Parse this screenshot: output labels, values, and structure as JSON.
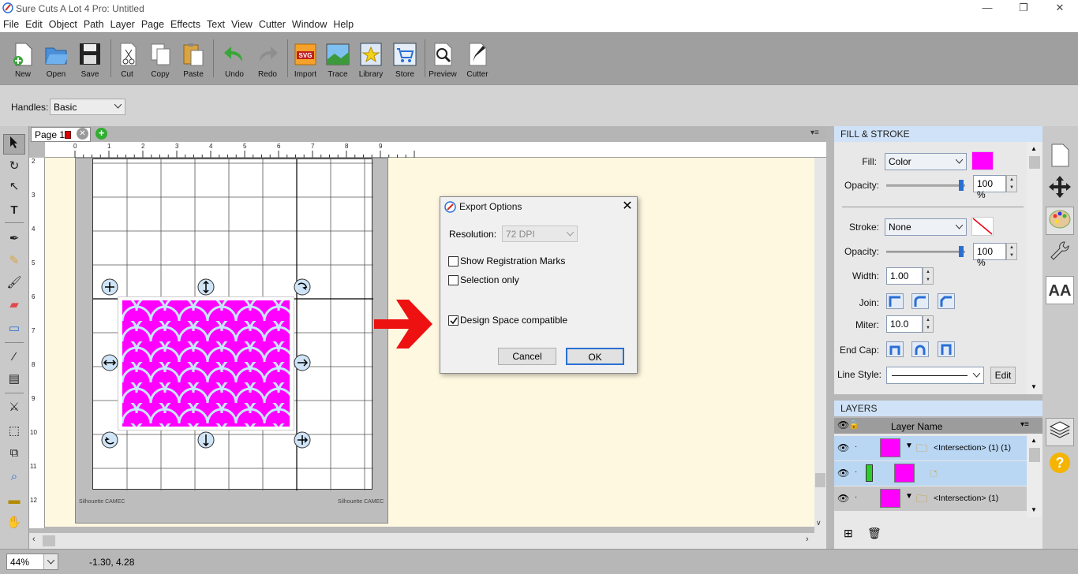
{
  "window": {
    "title": "Sure Cuts A Lot 4 Pro: Untitled",
    "minimize": "—",
    "maximize": "❐",
    "close": "✕"
  },
  "menu": [
    "File",
    "Edit",
    "Object",
    "Path",
    "Layer",
    "Page",
    "Effects",
    "Text",
    "View",
    "Cutter",
    "Window",
    "Help"
  ],
  "toolbar": {
    "new": "New",
    "open": "Open",
    "save": "Save",
    "cut": "Cut",
    "copy": "Copy",
    "paste": "Paste",
    "undo": "Undo",
    "redo": "Redo",
    "import": "Import",
    "trace": "Trace",
    "library": "Library",
    "store": "Store",
    "preview": "Preview",
    "cutter": "Cutter"
  },
  "options": {
    "handles_label": "Handles:",
    "handles_value": "Basic"
  },
  "page_tab": {
    "label": "Page 1"
  },
  "ruler": {
    "h": [
      "0",
      "1",
      "2",
      "3",
      "4",
      "5",
      "6",
      "7",
      "8",
      "9"
    ],
    "v": [
      "2",
      "3",
      "4",
      "5",
      "6",
      "7",
      "8",
      "9",
      "10",
      "11",
      "12"
    ]
  },
  "mat": {
    "brand_left": "Silhouette CAMEC",
    "brand_right": "Silhouette CAMEC"
  },
  "dialog": {
    "title": "Export Options",
    "resolution_label": "Resolution:",
    "resolution_value": "72 DPI",
    "show_registration": "Show Registration Marks",
    "selection_only": "Selection only",
    "design_space": "Design Space compatible",
    "show_registration_checked": false,
    "selection_only_checked": false,
    "design_space_checked": true,
    "cancel": "Cancel",
    "ok": "OK"
  },
  "fill_stroke": {
    "header": "FILL & STROKE",
    "fill_label": "Fill:",
    "fill_type": "Color",
    "fill_color": "#ff00ff",
    "opacity_label": "Opacity:",
    "fill_opacity": "100 %",
    "stroke_label": "Stroke:",
    "stroke_type": "None",
    "stroke_opacity": "100 %",
    "width_label": "Width:",
    "width_value": "1.00",
    "join_label": "Join:",
    "miter_label": "Miter:",
    "miter_value": "10.0",
    "endcap_label": "End Cap:",
    "linestyle_label": "Line Style:",
    "edit_label": "Edit"
  },
  "layers": {
    "header": "LAYERS",
    "col_name": "Layer Name",
    "rows": [
      {
        "name": "<Intersection> (1) (1)"
      },
      {
        "name": ""
      },
      {
        "name": "<Intersection> (1)"
      }
    ]
  },
  "status": {
    "zoom": "44%",
    "coords": "-1.30, 4.28"
  },
  "colors": {
    "accent_magenta": "#ff00ff",
    "arrow_red": "#ee1111",
    "panel_header": "#cfe2f7"
  }
}
